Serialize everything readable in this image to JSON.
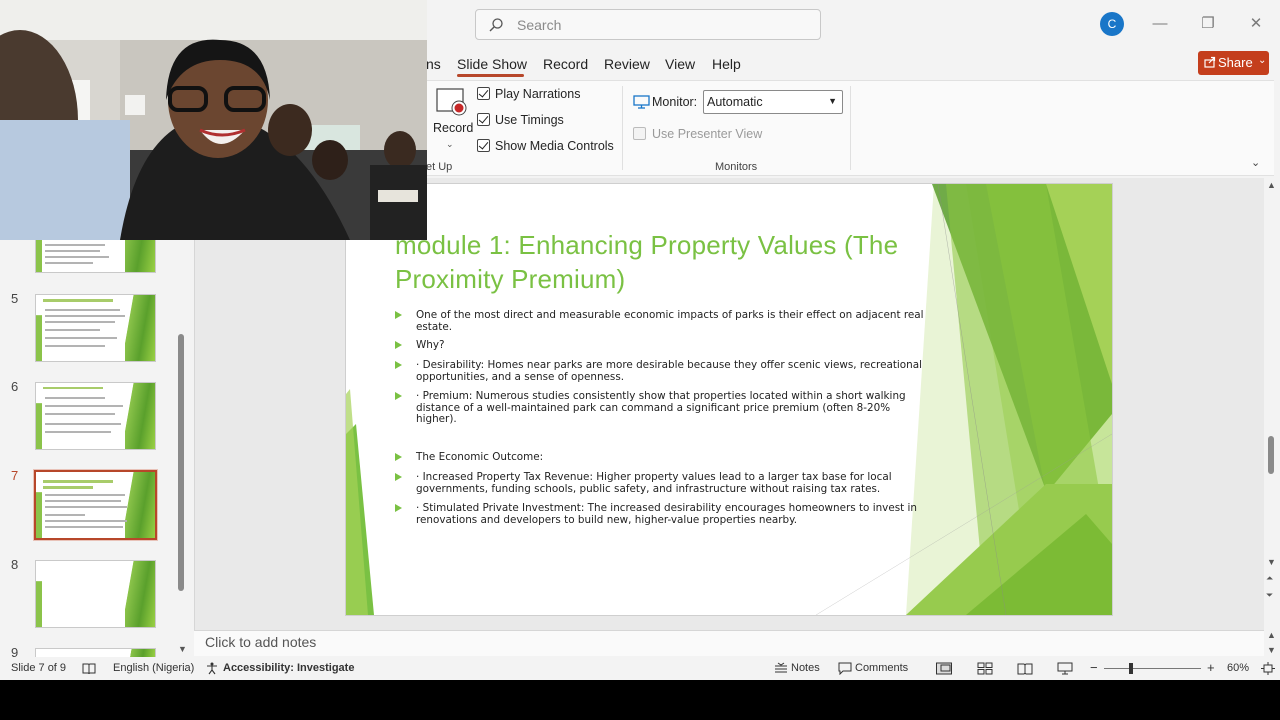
{
  "search": {
    "placeholder": "Search"
  },
  "account": {
    "initial": "C"
  },
  "window": {
    "minimize": "—",
    "restore": "❐",
    "close": "✕"
  },
  "ribbon": {
    "tabs": [
      "ns",
      "Slide Show",
      "Record",
      "Review",
      "View",
      "Help"
    ],
    "active_tab": "Slide Show",
    "share_label": "Share",
    "record_label": "Record",
    "set_up_group": "et Up",
    "checkboxes": [
      {
        "label": "Play Narrations",
        "checked": true
      },
      {
        "label": "Use Timings",
        "checked": true
      },
      {
        "label": "Show Media Controls",
        "checked": true
      }
    ],
    "monitor_label": "Monitor:",
    "monitor_value": "Automatic",
    "presenter_view_label": "Use Presenter View",
    "monitors_group": "Monitors"
  },
  "thumbnails": {
    "numbers": [
      "5",
      "6",
      "7",
      "8",
      "9"
    ],
    "current": "7"
  },
  "slide": {
    "title": "module 1: Enhancing Property Values (The Proximity Premium)",
    "bullets": [
      " One of the most direct and measurable economic impacts of parks is their effect on adjacent real estate.",
      " Why?",
      " · Desirability: Homes near parks are more desirable because they offer scenic views, recreational opportunities, and a sense of openness.",
      "· Premium: Numerous studies consistently show that properties located within a short walking distance of a well-maintained park can command a significant price premium (often 8-20% higher).",
      "The Economic Outcome:",
      "· Increased Property Tax Revenue: Higher property values lead to a larger tax base for local governments, funding schools, public safety, and infrastructure without raising tax rates.",
      "· Stimulated Private Investment: The increased desirability encourages homeowners to invest in renovations and developers to build new, higher-value properties nearby."
    ]
  },
  "notes": {
    "placeholder": "Click to add notes"
  },
  "status": {
    "slide_counter": "Slide 7 of 9",
    "language": "English (Nigeria)",
    "accessibility": "Accessibility: Investigate",
    "notes_label": "Notes",
    "comments_label": "Comments",
    "zoom": "60%"
  },
  "colors": {
    "accent": "#b7472a",
    "share": "#c43e1c",
    "slide_green": "#7ac143"
  },
  "icons": [
    "search-icon",
    "record-icon",
    "monitor-icon",
    "share-icon",
    "book-icon",
    "accessibility-icon",
    "notes-icon",
    "comments-icon",
    "normal-view-icon",
    "slide-sorter-icon",
    "reading-view-icon",
    "slideshow-icon",
    "fit-window-icon"
  ]
}
